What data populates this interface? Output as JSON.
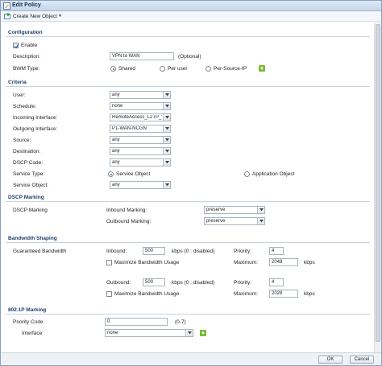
{
  "window": {
    "title": "Edit Policy"
  },
  "toolbar": {
    "create_label": "Create New Object"
  },
  "configuration": {
    "header": "Configuration",
    "enable_label": "Enable",
    "enable_checked": true,
    "description_label": "Description:",
    "description_value": "VPN to WAN",
    "description_hint": "(Optional)",
    "bwm_label": "BWM Type:",
    "bwm_options": [
      "Shared",
      "Per user",
      "Per-Source-IP"
    ],
    "bwm_selected": "Shared"
  },
  "criteria": {
    "header": "Criteria",
    "user_label": "User:",
    "user_value": "any",
    "schedule_label": "Schedule:",
    "schedule_value": "none",
    "incoming_label": "Incoming Interface:",
    "incoming_value": "RemoteAccess_L2TP_W",
    "outgoing_label": "Outgoing Interface:",
    "outgoing_value": "P1-WAN-NCGN",
    "source_label": "Source:",
    "source_value": "any",
    "destination_label": "Destination:",
    "destination_value": "any",
    "dscp_label": "DSCP Code:",
    "dscp_value": "any",
    "service_type_label": "Service Type:",
    "service_type_options": [
      "Service Object",
      "Application Object"
    ],
    "service_type_selected": "Service Object",
    "service_object_label": "Service Object:",
    "service_object_value": "any"
  },
  "dscp_marking": {
    "header": "DSCP Marking",
    "row_label": "DSCP Marking",
    "inbound_label": "Inbound Marking:",
    "inbound_value": "preserve",
    "outbound_label": "Outbound Marking:",
    "outbound_value": "preserve"
  },
  "bandwidth": {
    "header": "Bandwidth Shaping",
    "row_label": "Guaranteed Bandwidth",
    "inbound_label": "Inbound:",
    "inbound_value": "500",
    "unit_disabled": "kbps (0 : disabled)",
    "inbound_priority_label": "Priority:",
    "inbound_priority_value": "4",
    "inbound_max_usage_label": "Maximize Bandwidth Usage",
    "inbound_maximum_label": "Maximum:",
    "inbound_maximum_value": "2048",
    "kbps": "kbps",
    "outbound_label": "Outbound:",
    "outbound_value": "500",
    "outbound_priority_label": "Priority:",
    "outbound_priority_value": "4",
    "outbound_max_usage_label": "Maximize Bandwidth Usage",
    "outbound_maximum_label": "Maximum:",
    "outbound_maximum_value": "2028"
  },
  "dot1p": {
    "header": "802.1P Marking",
    "priority_label": "Priority Code",
    "priority_value": "0",
    "priority_range": "(0-7)",
    "interface_label": "Interface",
    "interface_value": "none"
  },
  "footer": {
    "ok_label": "OK",
    "cancel_label": "Cancel"
  },
  "colors": {
    "accent": "#2a6fb0",
    "header_text": "#1f3f66",
    "info_green": "#79b833"
  }
}
